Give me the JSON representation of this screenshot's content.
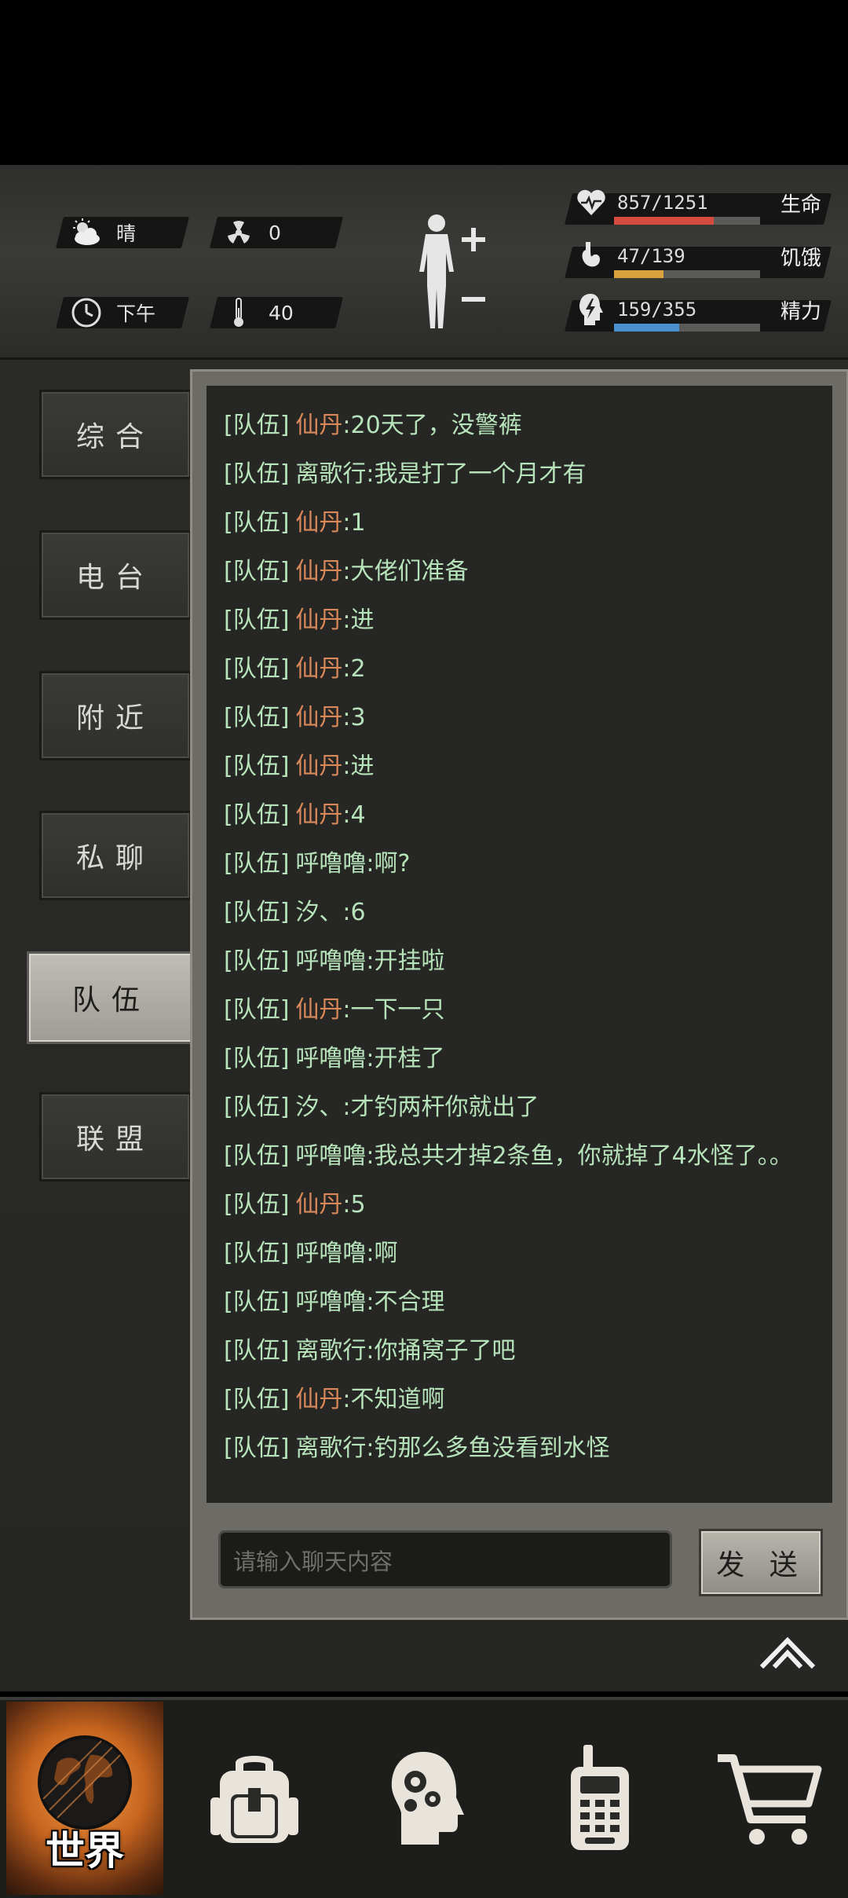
{
  "status": {
    "weather": "晴",
    "radiation": "0",
    "time_of_day": "下午",
    "temperature": "40",
    "health": {
      "text": "857/1251",
      "label": "生命",
      "fraction": 0.685,
      "color": "#d64b3f"
    },
    "hunger": {
      "text": "47/139",
      "label": "饥饿",
      "fraction": 0.338,
      "color": "#d9a23c"
    },
    "energy": {
      "text": "159/355",
      "label": "精力",
      "fraction": 0.448,
      "color": "#4a8fd0"
    }
  },
  "sidebar": {
    "items": [
      {
        "label": "综合",
        "active": false
      },
      {
        "label": "电台",
        "active": false
      },
      {
        "label": "附近",
        "active": false
      },
      {
        "label": "私聊",
        "active": false
      },
      {
        "label": "队伍",
        "active": true
      },
      {
        "label": "联盟",
        "active": false
      }
    ]
  },
  "chat": {
    "messages": [
      {
        "channel": "[队伍]",
        "name": "仙丹",
        "text": ":20天了，没警裤",
        "highlight": true
      },
      {
        "channel": "[队伍]",
        "name": "离歌行",
        "text": ":我是打了一个月才有",
        "highlight": false
      },
      {
        "channel": "[队伍]",
        "name": "仙丹",
        "text": ":1",
        "highlight": true
      },
      {
        "channel": "[队伍]",
        "name": "仙丹",
        "text": ":大佬们准备",
        "highlight": true
      },
      {
        "channel": "[队伍]",
        "name": "仙丹",
        "text": ":进",
        "highlight": true
      },
      {
        "channel": "[队伍]",
        "name": "仙丹",
        "text": ":2",
        "highlight": true
      },
      {
        "channel": "[队伍]",
        "name": "仙丹",
        "text": ":3",
        "highlight": true
      },
      {
        "channel": "[队伍]",
        "name": "仙丹",
        "text": ":进",
        "highlight": true
      },
      {
        "channel": "[队伍]",
        "name": "仙丹",
        "text": ":4",
        "highlight": true
      },
      {
        "channel": "[队伍]",
        "name": "呼噜噜",
        "text": ":啊?",
        "highlight": false
      },
      {
        "channel": "[队伍]",
        "name": "汐、",
        "text": ":6",
        "highlight": false
      },
      {
        "channel": "[队伍]",
        "name": "呼噜噜",
        "text": ":开挂啦",
        "highlight": false
      },
      {
        "channel": "[队伍]",
        "name": "仙丹",
        "text": ":一下一只",
        "highlight": true
      },
      {
        "channel": "[队伍]",
        "name": "呼噜噜",
        "text": ":开桂了",
        "highlight": false
      },
      {
        "channel": "[队伍]",
        "name": "汐、",
        "text": ":才钓两杆你就出了",
        "highlight": false
      },
      {
        "channel": "[队伍]",
        "name": "呼噜噜",
        "text": ":我总共才掉2条鱼，你就掉了4水怪了。。",
        "highlight": false
      },
      {
        "channel": "[队伍]",
        "name": "仙丹",
        "text": ":5",
        "highlight": true
      },
      {
        "channel": "[队伍]",
        "name": "呼噜噜",
        "text": ":啊",
        "highlight": false
      },
      {
        "channel": "[队伍]",
        "name": "呼噜噜",
        "text": ":不合理",
        "highlight": false
      },
      {
        "channel": "[队伍]",
        "name": "离歌行",
        "text": ":你捅窝子了吧",
        "highlight": false
      },
      {
        "channel": "[队伍]",
        "name": "仙丹",
        "text": ":不知道啊",
        "highlight": true
      },
      {
        "channel": "[队伍]",
        "name": "离歌行",
        "text": ":钓那么多鱼没看到水怪",
        "highlight": false
      }
    ],
    "input_placeholder": "请输入聊天内容",
    "send_label": "发 送"
  },
  "bottom_nav": {
    "world_label": "世界",
    "items": [
      "globe-icon",
      "backpack-icon",
      "head-gears-icon",
      "walkie-talkie-icon",
      "shopping-cart-icon"
    ]
  },
  "colors": {
    "chat_text": "#b6e3b9",
    "chat_name_highlight": "#d9885a",
    "health_bar": "#d64b3f",
    "hunger_bar": "#d9a23c",
    "energy_bar": "#4a8fd0"
  }
}
